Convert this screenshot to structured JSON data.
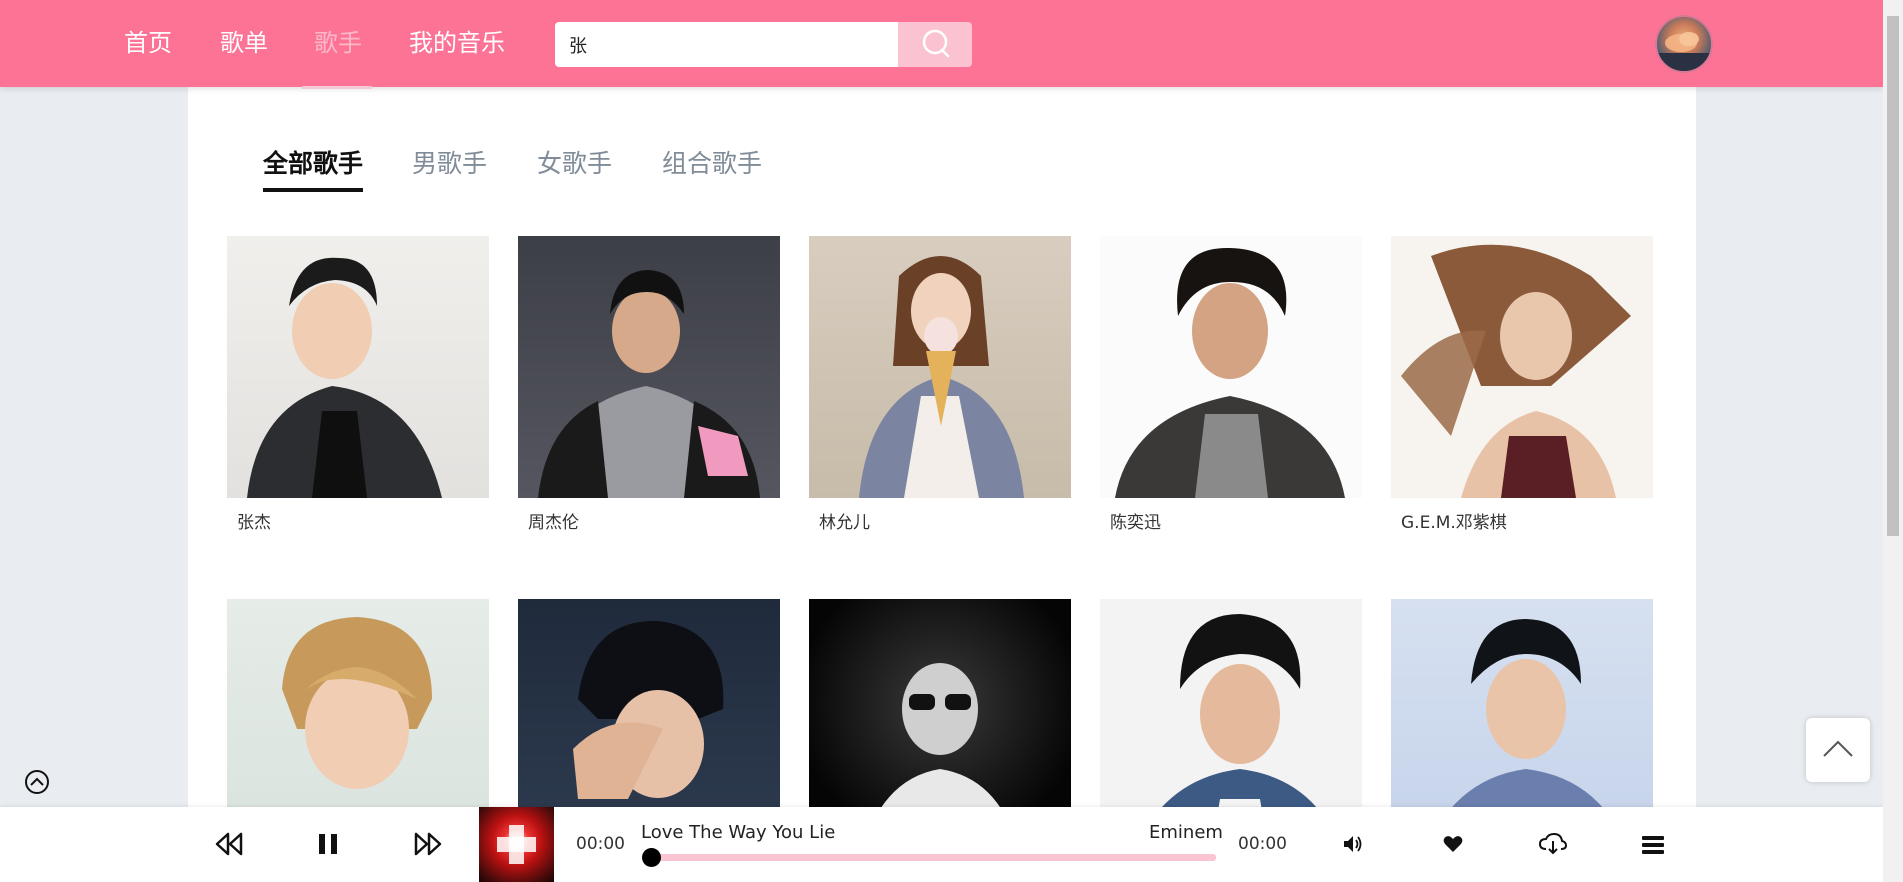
{
  "nav": {
    "items": [
      "首页",
      "歌单",
      "歌手",
      "我的音乐"
    ],
    "active": "歌手"
  },
  "search": {
    "value": "张"
  },
  "tabs": [
    "全部歌手",
    "男歌手",
    "女歌手",
    "组合歌手"
  ],
  "singers": [
    {
      "name": "张杰"
    },
    {
      "name": "周杰伦"
    },
    {
      "name": "林允儿"
    },
    {
      "name": "陈奕迅"
    },
    {
      "name": "G.E.M.邓紫棋"
    },
    {
      "name": ""
    },
    {
      "name": ""
    },
    {
      "name": ""
    },
    {
      "name": ""
    },
    {
      "name": ""
    }
  ],
  "player": {
    "current_time": "00:00",
    "total_time": "00:00",
    "song_title": "Love The Way You Lie",
    "artist": "Eminem",
    "progress": 0
  },
  "colors": {
    "header": "#fc7395",
    "accent_light": "#fbc4d2",
    "page_bg": "#e9edf1"
  },
  "icons": [
    "search-icon",
    "rewind-icon",
    "pause-icon",
    "fast-forward-icon",
    "volume-icon",
    "heart-icon",
    "download-icon",
    "playlist-menu-icon",
    "chevron-up-icon",
    "collapse-chevron-icon"
  ]
}
